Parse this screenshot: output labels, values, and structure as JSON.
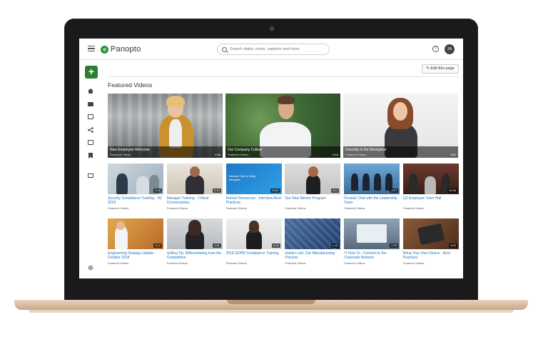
{
  "app": {
    "logo_text": "Panopto"
  },
  "search": {
    "placeholder": "Search slides, notes, captions and more"
  },
  "header": {
    "help_glyph": "?",
    "avatar_initials": "JA"
  },
  "rail": {
    "create_glyph": "+"
  },
  "main": {
    "edit_label": "✎ Edit this page",
    "section_title": "Featured Videos"
  },
  "featured": [
    {
      "title": "New Employee Welcome",
      "subtitle": "Featured Videos",
      "duration": "0:36"
    },
    {
      "title": "Our Company Culture",
      "subtitle": "Featured Videos",
      "duration": "0:16"
    },
    {
      "title": "Diversity in the Workplace",
      "subtitle": "Featured Videos",
      "duration": "0:51"
    }
  ],
  "videos": [
    {
      "title": "Security Compliance Training - H2 2018",
      "subtitle": "Featured Videos",
      "duration": "0:16"
    },
    {
      "title": "Manager Training - Critical Conversations",
      "subtitle": "Featured Videos",
      "duration": "0:13"
    },
    {
      "title": "Human Resources - Interview Best Practices",
      "subtitle": "Featured Videos",
      "duration": "13:52"
    },
    {
      "title": "Our New Mentor Program",
      "subtitle": "Featured Videos",
      "duration": "0:21"
    },
    {
      "title": "Fireside Chat with the Leadership Team",
      "subtitle": "Featured Videos",
      "duration": "0:17"
    },
    {
      "title": "Q2 Employee Town Hall",
      "subtitle": "Featured Videos",
      "duration": "34:56"
    },
    {
      "title": "Engineering Strategy Update - October 2018",
      "subtitle": "Featured Videos",
      "duration": "0:12"
    },
    {
      "title": "Selling Tip: Differentiating from the Competition",
      "subtitle": "Featured Videos",
      "duration": "1:01"
    },
    {
      "title": "2018 GDPR Compliance Training",
      "subtitle": "Featured Videos",
      "duration": "0:15"
    },
    {
      "title": "Inside Look: Our Manufacturing Process",
      "subtitle": "Featured Videos",
      "duration": "1:16"
    },
    {
      "title": "IT How To - Connect to the Corporate Network",
      "subtitle": "Featured Videos",
      "duration": "2:25"
    },
    {
      "title": "Bring Your Own Device - Best Practices",
      "subtitle": "Featured Videos",
      "duration": "4:02"
    }
  ],
  "thumb_text": {
    "human_resources": "Interview Tips for Hiring Managers"
  },
  "colors": {
    "accent_green": "#2e7d32",
    "link_blue": "#1a73c8"
  },
  "icons": [
    "menu-icon",
    "home-icon",
    "folder-icon",
    "stack-icon",
    "share-icon",
    "list-icon",
    "bookmark-icon",
    "folder-outline-icon",
    "gear-icon",
    "search-icon",
    "help-icon",
    "pencil-icon"
  ]
}
